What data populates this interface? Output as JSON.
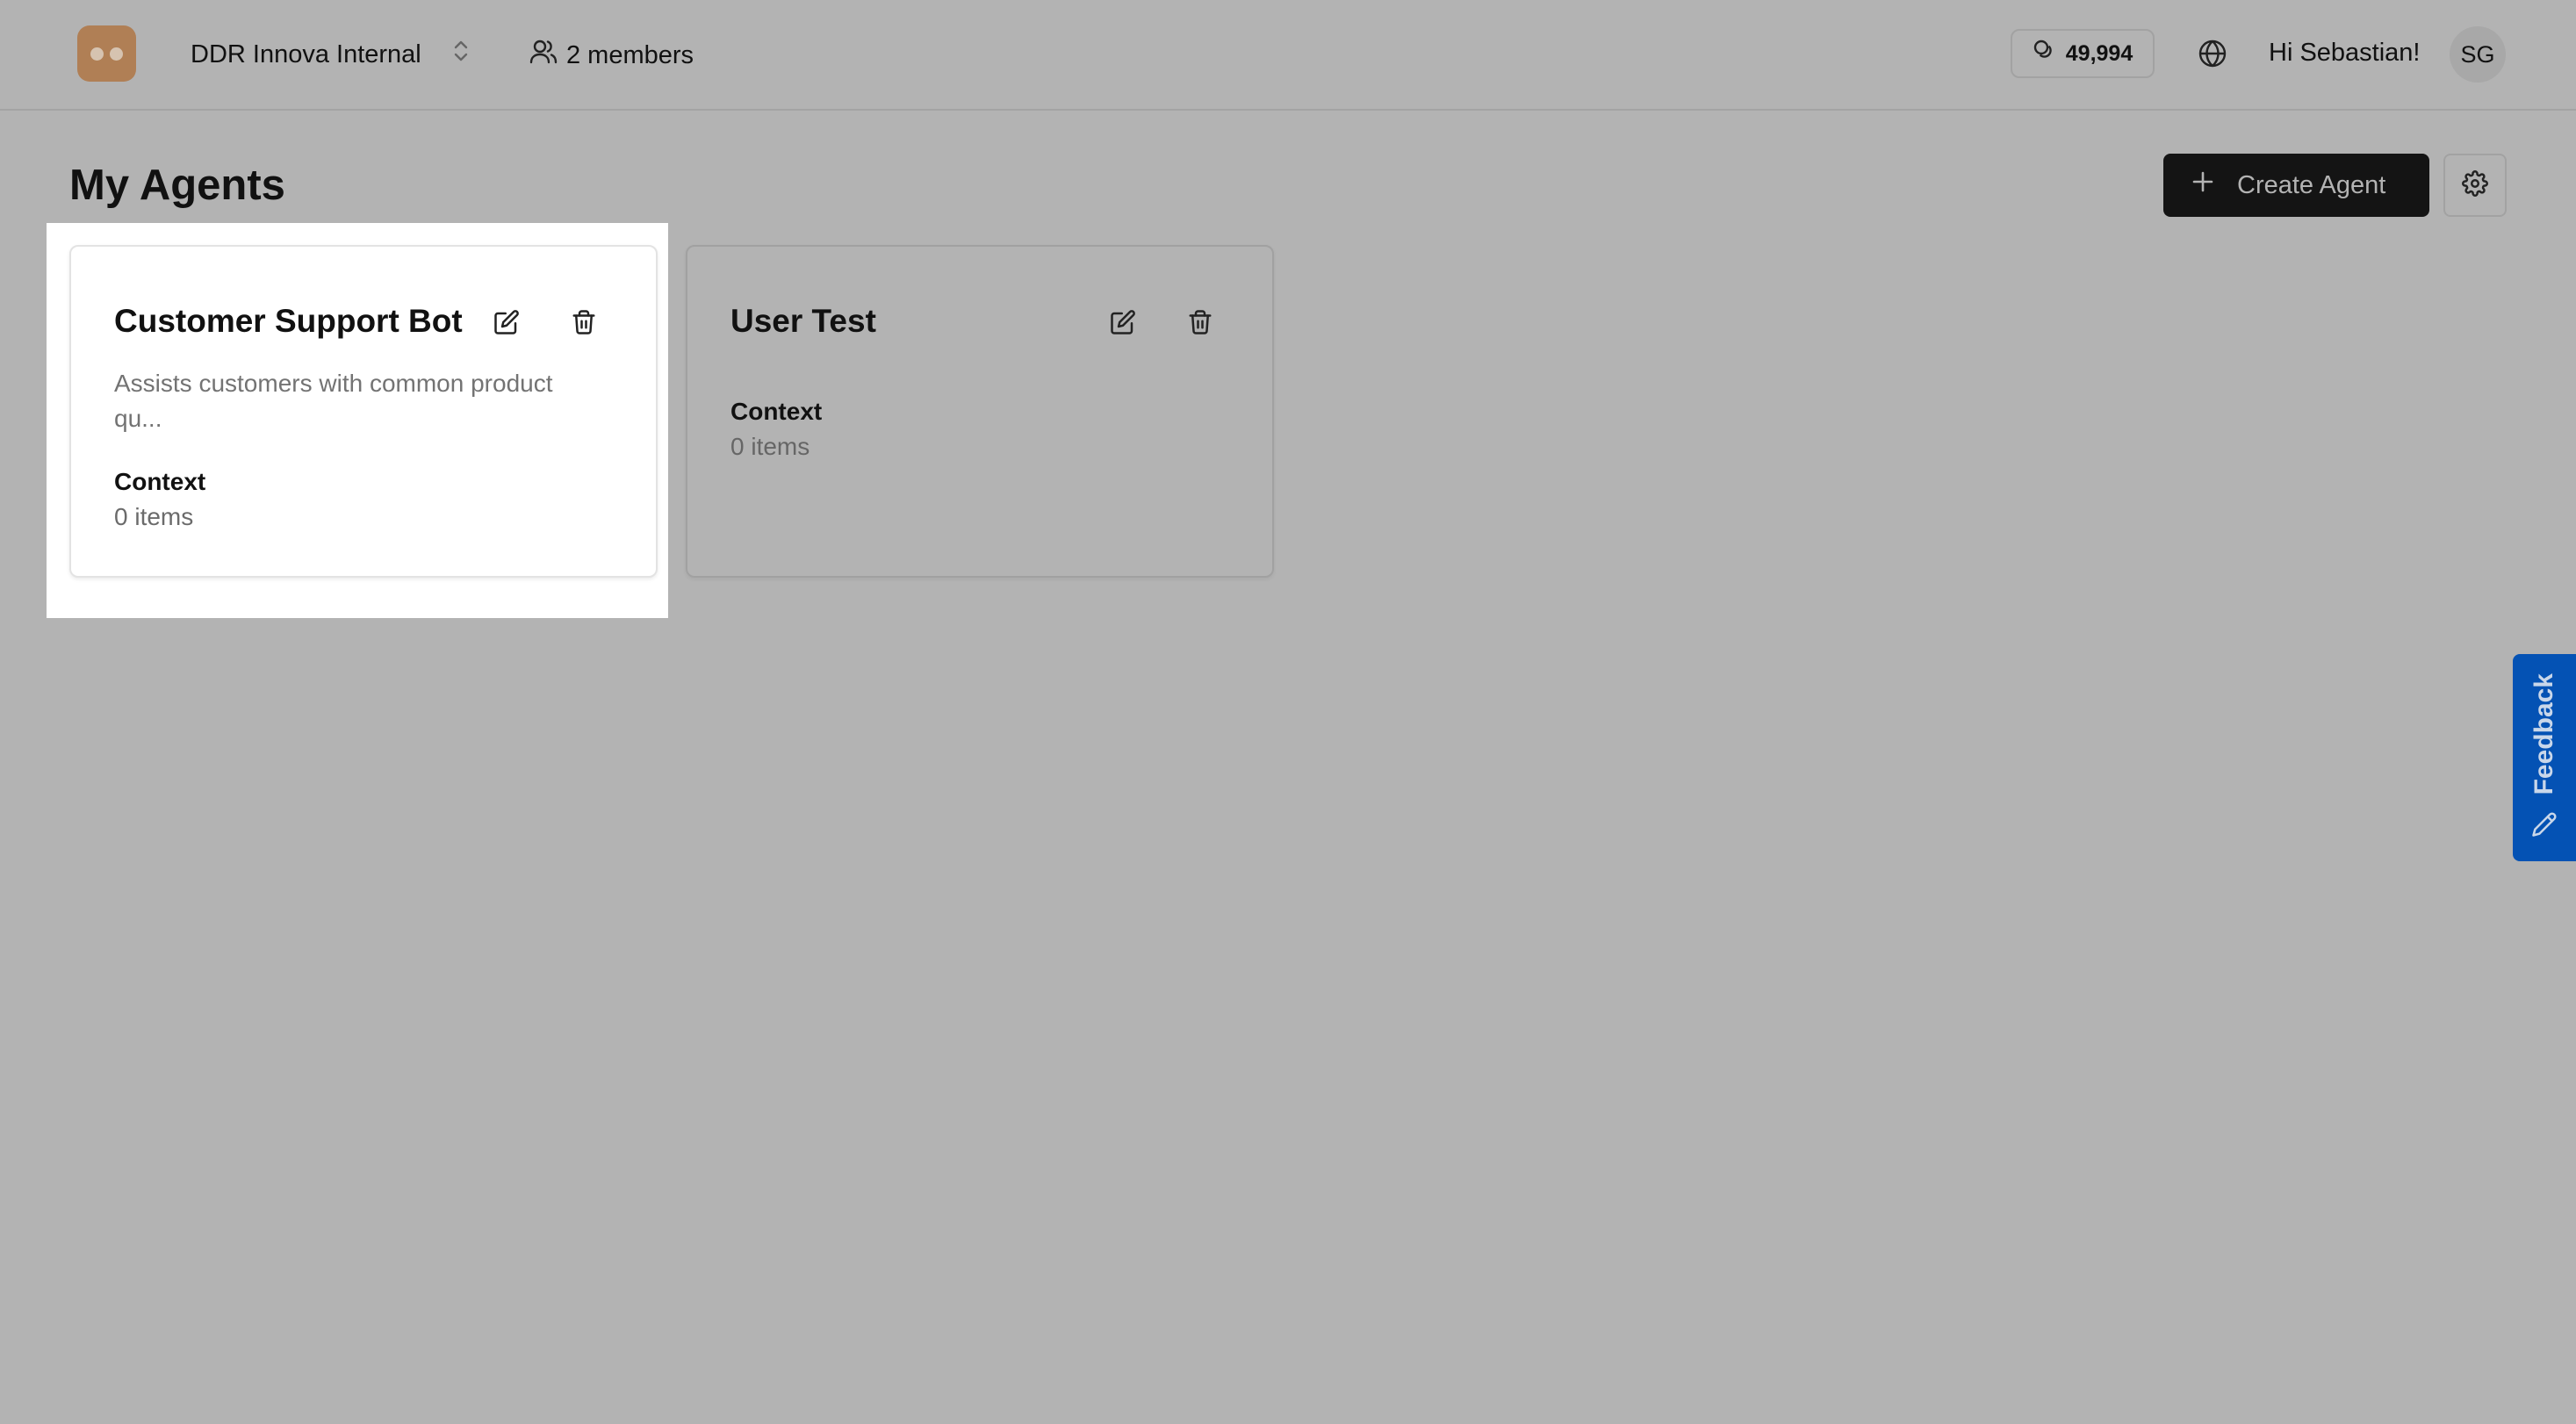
{
  "header": {
    "org_name": "DDR Innova Internal",
    "members": "2 members",
    "credits": "49,994",
    "greeting": "Hi Sebastian!",
    "avatar_initials": "SG"
  },
  "main": {
    "title": "My Agents",
    "create_label": "Create Agent"
  },
  "agents": [
    {
      "name": "Customer Support Bot",
      "description": "Assists customers with common product qu...",
      "context_label": "Context",
      "context_count": "0 items"
    },
    {
      "name": "User Test",
      "description": "",
      "context_label": "Context",
      "context_count": "0 items"
    }
  ],
  "feedback": {
    "label": "Feedback"
  },
  "colors": {
    "overlay": "#b3b3b3",
    "logo": "#b07f55",
    "primary_button": "#141414",
    "feedback": "#0452b4"
  }
}
